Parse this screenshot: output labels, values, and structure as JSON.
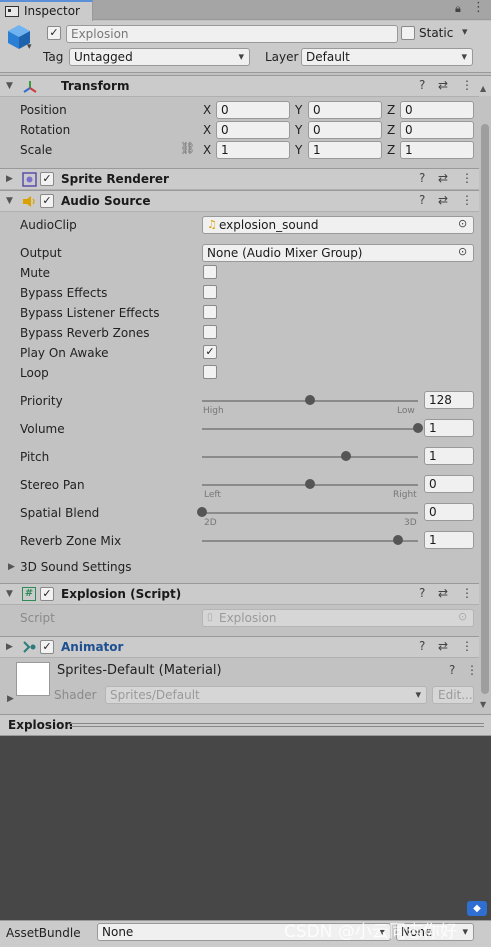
{
  "tab": {
    "label": "Inspector"
  },
  "object": {
    "name": "Explosion",
    "static_label": "Static",
    "tag_label": "Tag",
    "tag_value": "Untagged",
    "layer_label": "Layer",
    "layer_value": "Default"
  },
  "transform": {
    "title": "Transform",
    "position_label": "Position",
    "rotation_label": "Rotation",
    "scale_label": "Scale",
    "axis_x": "X",
    "axis_y": "Y",
    "axis_z": "Z",
    "position": [
      "0",
      "0",
      "0"
    ],
    "rotation": [
      "0",
      "0",
      "0"
    ],
    "scale": [
      "1",
      "1",
      "1"
    ]
  },
  "sprite_renderer": {
    "title": "Sprite Renderer"
  },
  "audio_source": {
    "title": "Audio Source",
    "audioclip_label": "AudioClip",
    "audioclip_value": "explosion_sound",
    "output_label": "Output",
    "output_value": "None (Audio Mixer Group)",
    "toggles": [
      {
        "label": "Mute",
        "checked": false
      },
      {
        "label": "Bypass Effects",
        "checked": false
      },
      {
        "label": "Bypass Listener Effects",
        "checked": false
      },
      {
        "label": "Bypass Reverb Zones",
        "checked": false
      },
      {
        "label": "Play On Awake",
        "checked": true
      },
      {
        "label": "Loop",
        "checked": false
      }
    ],
    "priority": {
      "label": "Priority",
      "value": "128",
      "min_label": "High",
      "max_label": "Low",
      "fraction": 0.5
    },
    "volume": {
      "label": "Volume",
      "value": "1",
      "fraction": 1.0
    },
    "pitch": {
      "label": "Pitch",
      "value": "1",
      "fraction": 0.667
    },
    "stereo_pan": {
      "label": "Stereo Pan",
      "value": "0",
      "min_label": "Left",
      "max_label": "Right",
      "fraction": 0.5
    },
    "spatial_blend": {
      "label": "Spatial Blend",
      "value": "0",
      "min_label": "2D",
      "max_label": "3D",
      "fraction": 0.0
    },
    "reverb_mix": {
      "label": "Reverb Zone Mix",
      "value": "1",
      "fraction": 0.909
    },
    "sound_settings_label": "3D Sound Settings",
    "checkmark": "✓"
  },
  "script": {
    "title": "Explosion (Script)",
    "script_label": "Script",
    "script_value": "Explosion"
  },
  "animator": {
    "title": "Animator"
  },
  "material": {
    "title": "Sprites-Default (Material)",
    "shader_label": "Shader",
    "shader_value": "Sprites/Default",
    "edit_label": "Edit..."
  },
  "preview": {
    "title": "Explosion"
  },
  "assetbundle": {
    "label": "AssetBundle",
    "value": "None",
    "variant_value": "None"
  },
  "watermark": "CSDN @小云同志你好",
  "colors": {
    "accent": "#5b8fd6",
    "animator_title": "#1d4f91"
  }
}
